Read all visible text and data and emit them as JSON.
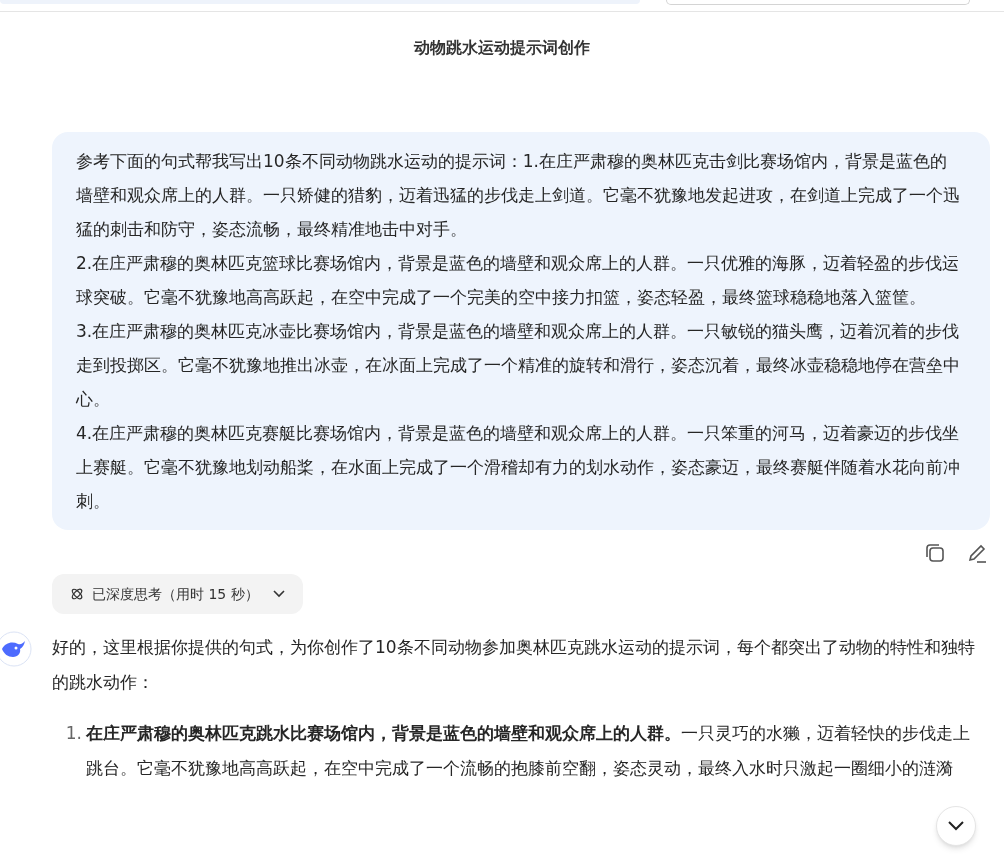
{
  "conversation_title": "动物跳水运动提示词创作",
  "user_message": {
    "paragraphs": [
      "参考下面的句式帮我写出10条不同动物跳水运动的提示词：1.在庄严肃穆的奥林匹克击剑比赛场馆内，背景是蓝色的墙壁和观众席上的人群。一只矫健的猎豹，迈着迅猛的步伐走上剑道。它毫不犹豫地发起进攻，在剑道上完成了一个迅猛的刺击和防守，姿态流畅，最终精准地击中对手。",
      "2.在庄严肃穆的奥林匹克篮球比赛场馆内，背景是蓝色的墙壁和观众席上的人群。一只优雅的海豚，迈着轻盈的步伐运球突破。它毫不犹豫地高高跃起，在空中完成了一个完美的空中接力扣篮，姿态轻盈，最终篮球稳稳地落入篮筐。",
      "3.在庄严肃穆的奥林匹克冰壶比赛场馆内，背景是蓝色的墙壁和观众席上的人群。一只敏锐的猫头鹰，迈着沉着的步伐走到投掷区。它毫不犹豫地推出冰壶，在冰面上完成了一个精准的旋转和滑行，姿态沉着，最终冰壶稳稳地停在营垒中心。",
      "4.在庄严肃穆的奥林匹克赛艇比赛场馆内，背景是蓝色的墙壁和观众席上的人群。一只笨重的河马，迈着豪迈的步伐坐上赛艇。它毫不犹豫地划动船桨，在水面上完成了一个滑稽却有力的划水动作，姿态豪迈，最终赛艇伴随着水花向前冲刺。"
    ]
  },
  "thinking": {
    "label": "已深度思考（用时 15 秒）",
    "expanded": false
  },
  "response": {
    "intro": "好的，这里根据你提供的句式，为你创作了10条不同动物参加奥林匹克跳水运动的提示词，每个都突出了动物的特性和独特的跳水动作：",
    "items": [
      {
        "number": "1.",
        "text": "**在庄严肃穆的奥林匹克跳水比赛场馆内，背景是蓝色的墙壁和观众席上的人群。**一只灵巧的水獭，迈着轻快的步伐走上跳台。它毫不犹豫地高高跃起，在空中完成了一个流畅的抱膝前空翻，姿态灵动，最终入水时只激起一圈细小的涟漪"
      }
    ]
  }
}
